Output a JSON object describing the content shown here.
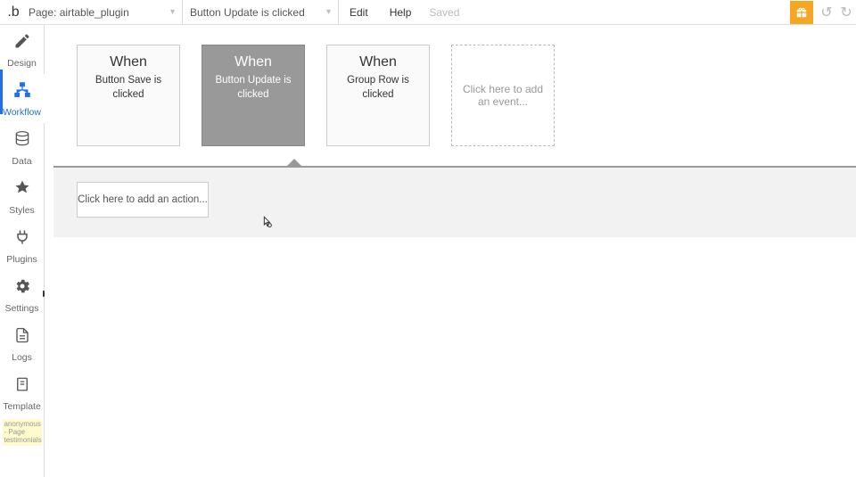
{
  "topbar": {
    "page_label": "Page: airtable_plugin",
    "event_label": "Button Update is clicked",
    "edit": "Edit",
    "help": "Help",
    "saved": "Saved"
  },
  "sidebar": {
    "items": [
      {
        "label": "Design"
      },
      {
        "label": "Workflow"
      },
      {
        "label": "Data"
      },
      {
        "label": "Styles"
      },
      {
        "label": "Plugins"
      },
      {
        "label": "Settings"
      },
      {
        "label": "Logs"
      },
      {
        "label": "Template"
      }
    ],
    "anon": "anonymous - Page testimonials"
  },
  "events": [
    {
      "when": "When",
      "desc": "Button Save is clicked",
      "selected": false
    },
    {
      "when": "When",
      "desc": "Button Update is clicked",
      "selected": true
    },
    {
      "when": "When",
      "desc": "Group Row is clicked",
      "selected": false
    }
  ],
  "add_event": "Click here to add an event...",
  "add_action": "Click here to add an action..."
}
